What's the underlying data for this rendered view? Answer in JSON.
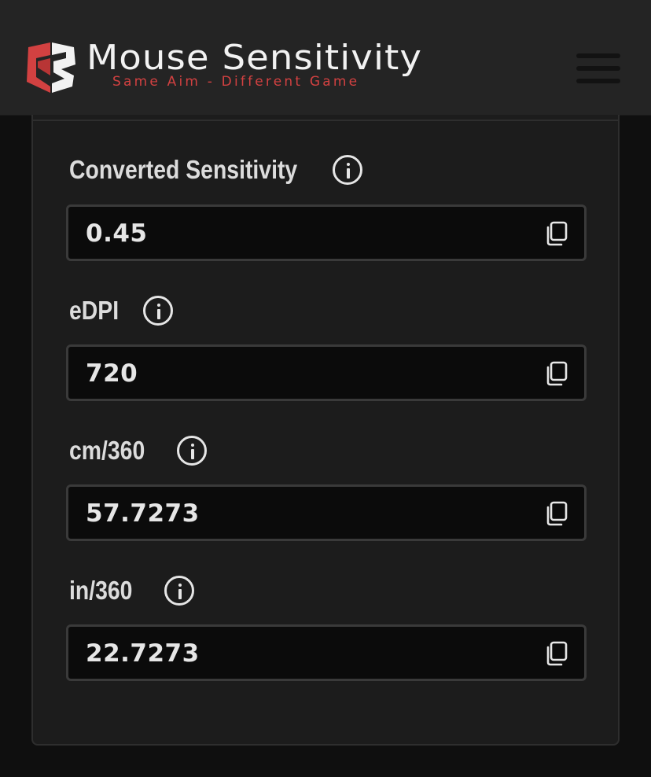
{
  "header": {
    "brand_title": "Mouse Sensitivity",
    "brand_tagline": "Same Aim - Different Game",
    "logo_icon": "mouse-sensitivity-logo",
    "menu_icon": "hamburger-menu-icon",
    "accent_color": "#d24141"
  },
  "fields": [
    {
      "label": "Converted Sensitivity",
      "value": "0.45",
      "info_icon": "info-icon",
      "copy_icon": "copy-icon"
    },
    {
      "label": "eDPI",
      "value": "720",
      "info_icon": "info-icon",
      "copy_icon": "copy-icon"
    },
    {
      "label": "cm/360",
      "value": "57.7273",
      "info_icon": "info-icon",
      "copy_icon": "copy-icon"
    },
    {
      "label": "in/360",
      "value": "22.7273",
      "info_icon": "info-icon",
      "copy_icon": "copy-icon"
    }
  ]
}
